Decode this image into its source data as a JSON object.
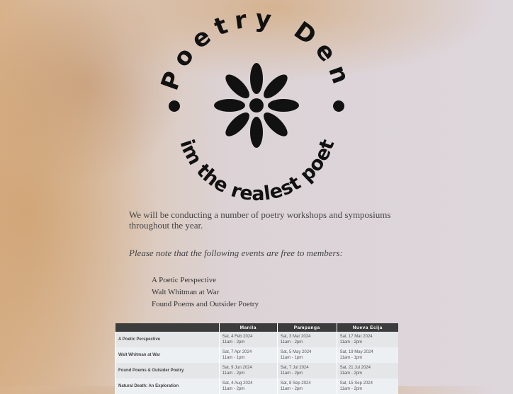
{
  "logo": {
    "title": "Poetry Den",
    "tagline": "im the realest poet",
    "icon": "flower-icon"
  },
  "intro": "We will be conducting a number of poetry workshops and symposiums throughout the year.",
  "note": "Please note that the following events are free to members:",
  "events": [
    "A Poetic Perspective",
    "Walt Whitman at War",
    "Found Poems and Outsider Poetry"
  ],
  "schedule": {
    "columns": [
      "",
      "Manila",
      "Pampanga",
      "Nueva Ecija"
    ],
    "rows": [
      {
        "name": "A Poetic Perspective",
        "cells": [
          [
            "Sat, 4 Feb 2024",
            "11am - 2pm"
          ],
          [
            "Sat, 3 Mar 2024",
            "11am - 2pm"
          ],
          [
            "Sat, 17 Mar 2024",
            "11am - 2pm"
          ]
        ]
      },
      {
        "name": "Walt Whitman at War",
        "cells": [
          [
            "Sat, 7 Apr 2024",
            "11am - 1pm"
          ],
          [
            "Sat, 5 May 2024",
            "11am - 1pm"
          ],
          [
            "Sat, 19 May 2024",
            "11am - 1pm"
          ]
        ]
      },
      {
        "name": "Found Poems & Outsider Poetry",
        "cells": [
          [
            "Sat, 9 Jun 2024",
            "11am - 2pm"
          ],
          [
            "Sat, 7 Jul 2024",
            "11am - 2pm"
          ],
          [
            "Sat, 21 Jul 2024",
            "11am - 2pm"
          ]
        ]
      },
      {
        "name": "Natural Death: An Exploration",
        "cells": [
          [
            "Sat, 4 Aug 2024",
            "11am - 2pm"
          ],
          [
            "Sat, 8 Sep 2024",
            "11am - 2pm"
          ],
          [
            "Sat, 15 Sep 2024",
            "11am - 2pm"
          ]
        ]
      }
    ]
  }
}
